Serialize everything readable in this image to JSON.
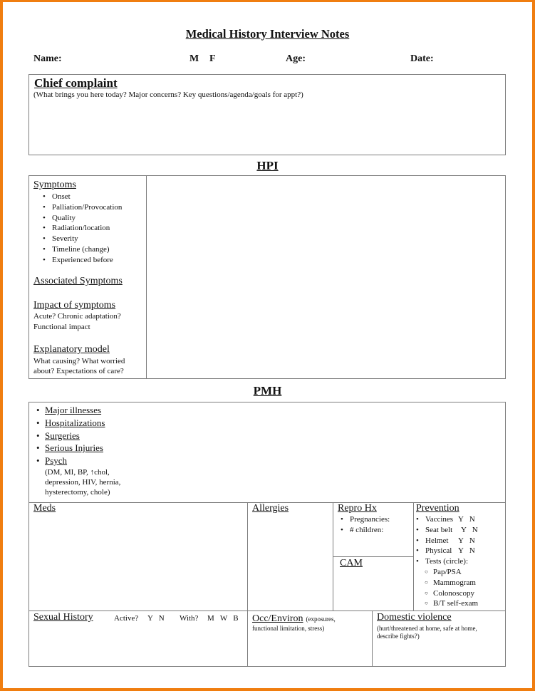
{
  "title": "Medical History Interview Notes",
  "header": {
    "name_label": "Name:",
    "sex_m": "M",
    "sex_f": "F",
    "age_label": "Age:",
    "date_label": "Date:"
  },
  "chief_complaint": {
    "heading": "Chief complaint",
    "prompt": "(What brings you here today? Major concerns? Key questions/agenda/goals for appt?)"
  },
  "hpi": {
    "heading": "HPI",
    "symptoms_heading": "Symptoms",
    "symptoms": [
      "Onset",
      "Palliation/Provocation",
      "Quality",
      "Radiation/location",
      "Severity",
      "Timeline (change)",
      "Experienced before"
    ],
    "associated_heading": "Associated Symptoms",
    "impact_heading": "Impact of symptoms",
    "impact_lines": [
      "Acute? Chronic adaptation?",
      "Functional impact"
    ],
    "explanatory_heading": "Explanatory model",
    "explanatory_lines": [
      "What causing? What worried",
      "about?  Expectations of care?"
    ]
  },
  "pmh": {
    "heading": "PMH",
    "items": [
      "Major illnesses",
      "Hospitalizations",
      "Surgeries",
      "Serious Injuries",
      "Psych"
    ],
    "examples_lines": [
      "(DM, MI, BP, ↑chol,",
      "depression, HIV, hernia,",
      "hysterectomy, chole)"
    ]
  },
  "meds": {
    "heading": "Meds"
  },
  "allergies": {
    "heading": "Allergies"
  },
  "repro": {
    "heading": "Repro Hx",
    "items": [
      "Pregnancies:",
      "# children:"
    ]
  },
  "cam": {
    "heading": "CAM"
  },
  "prevention": {
    "heading": "Prevention",
    "yn_items": [
      {
        "label": "Vaccines",
        "yn": "Y   N"
      },
      {
        "label": "Seat belt",
        "yn": "Y   N"
      },
      {
        "label": "Helmet",
        "yn": "Y   N"
      },
      {
        "label": "Physical",
        "yn": "Y   N"
      }
    ],
    "tests_label": "Tests (circle):",
    "tests": [
      "Pap/PSA",
      "Mammogram",
      "Colonoscopy",
      "B/T self-exam"
    ]
  },
  "sexual_history": {
    "heading": "Sexual History",
    "active_label": "Active?",
    "active_options": "Y   N",
    "with_label": "With?",
    "with_options": "M   W   B"
  },
  "occ_environ": {
    "heading": "Occ/Environ",
    "note_inline": "(exposures,",
    "note_line2": "functional limitation,  stress)"
  },
  "domestic_violence": {
    "heading": "Domestic violence",
    "note_lines": [
      "(hurt/threatened at home, safe at home,",
      "describe fights?)"
    ]
  },
  "colors": {
    "frame": "#f07e10",
    "border": "#7d7d7d"
  }
}
